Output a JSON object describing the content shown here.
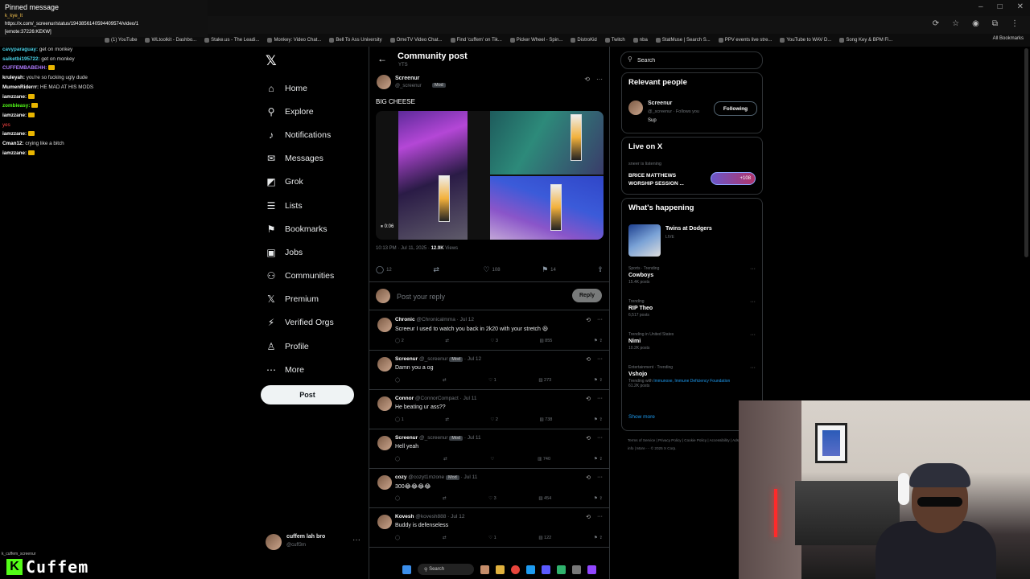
{
  "browser": {
    "window_controls": [
      "–",
      "□",
      "✕"
    ],
    "icons": [
      "⟳",
      "☆",
      "◉",
      "⧉",
      "⋮"
    ],
    "bookmarks": [
      "(1) YouTube",
      "WLtoolkit - Dashbo...",
      "Stake.us - The Leadi...",
      "Monkey: Video Chat...",
      "Bell To Ass University",
      "OmeTV Video Chat...",
      "Find 'cuffem' on Tik...",
      "Picker Wheel - Spin...",
      "DistroKid",
      "Twitch",
      "nba",
      "StatMuse | Search S...",
      "PPV events live stre...",
      "YouTube to WAV D...",
      "Song Key & BPM Fi..."
    ],
    "all_bookmarks": "All Bookmarks"
  },
  "pinned": {
    "title": "Pinned message",
    "user": "k_kye_lt",
    "url": "https://x.com/_screenur/status/1943856140594409574/video/1",
    "emote": "[emote:37226:KEKW]"
  },
  "chat": [
    {
      "user": "cavyparaguay:",
      "text": "get on monkey",
      "color": "#4bd3e8"
    },
    {
      "user": "saiketbi195722:",
      "text": "get on monkey",
      "color": "#4bd3e8"
    },
    {
      "user": "CUFFEMBABEHH:",
      "text": "",
      "emote": true,
      "color": "#b07cff"
    },
    {
      "user": "kruleyah:",
      "text": "you're so fucking ugly dude",
      "color": "#ffffff"
    },
    {
      "user": "MumenRiderrr:",
      "text": "HE MAD AT HIS MODS",
      "color": "#ffffff"
    },
    {
      "user": "iamzzane:",
      "text": "",
      "emote": true,
      "color": "#ffffff"
    },
    {
      "user": "zombieasy:",
      "text": "",
      "emote": true,
      "color": "#53fc18"
    },
    {
      "user": "iamzzane:",
      "text": "",
      "emote": true,
      "color": "#ffffff"
    },
    {
      "user": "",
      "text": "yes",
      "color": "#ff4444"
    },
    {
      "user": "iamzzane:",
      "text": "",
      "emote": true,
      "color": "#ffffff"
    },
    {
      "user": "Cman12:",
      "text": "crying like a bitch",
      "color": "#ffffff"
    },
    {
      "user": "iamzzane:",
      "text": "",
      "emote": true,
      "color": "#ffffff"
    }
  ],
  "chat_footer": "k_cuffem_screenur",
  "nav": [
    {
      "label": "Home",
      "icon": "⌂",
      "name": "home"
    },
    {
      "label": "Explore",
      "icon": "⚲",
      "name": "explore"
    },
    {
      "label": "Notifications",
      "icon": "♪",
      "name": "notifications"
    },
    {
      "label": "Messages",
      "icon": "✉",
      "name": "messages"
    },
    {
      "label": "Grok",
      "icon": "◩",
      "name": "grok"
    },
    {
      "label": "Lists",
      "icon": "☰",
      "name": "lists"
    },
    {
      "label": "Bookmarks",
      "icon": "⚑",
      "name": "bookmarks"
    },
    {
      "label": "Jobs",
      "icon": "▣",
      "name": "jobs"
    },
    {
      "label": "Communities",
      "icon": "⚇",
      "name": "communities"
    },
    {
      "label": "Premium",
      "icon": "𝕏",
      "name": "premium"
    },
    {
      "label": "Verified Orgs",
      "icon": "⚡",
      "name": "verified-orgs"
    },
    {
      "label": "Profile",
      "icon": "♙",
      "name": "profile"
    },
    {
      "label": "More",
      "icon": "⋯",
      "name": "more"
    }
  ],
  "x_logo": "𝕏",
  "post_button": "Post",
  "profile": {
    "name": "cuffem lah bro",
    "handle": "@cuff3m",
    "more": "···"
  },
  "main": {
    "back": "←",
    "title": "Community post",
    "subtitle": "YTS",
    "post": {
      "author": "Screenur",
      "handle": "@_screenur",
      "mod": "Mod",
      "text": "BIG CHEESE",
      "video_time": "0:06",
      "time": "10:13 PM · Jul 11, 2025 · ",
      "views_count": "12.9K",
      "views_label": " Views",
      "actions": {
        "replies": "12",
        "reposts": "",
        "likes": "108",
        "bookmarks": "14"
      }
    },
    "reply_placeholder": "Post your reply",
    "reply_button": "Reply",
    "replies": [
      {
        "name": "Chronic",
        "meta": "@Chronicalmma · Jul 12",
        "mod": "",
        "text": "Screeur I used to watch you back in 2k20 with your stretch 😃",
        "replies": "2",
        "reposts": "",
        "likes": "3",
        "views": "855"
      },
      {
        "name": "Screenur",
        "meta": "@_screenur",
        "mod": "Mod",
        "date": "· Jul 12",
        "text": "Damn you a og",
        "replies": "",
        "reposts": "",
        "likes": "1",
        "views": "273"
      },
      {
        "name": "Connor",
        "meta": "@ConnorCompact · Jul 11",
        "mod": "",
        "text": "He beating ur ass??",
        "replies": "1",
        "reposts": "",
        "likes": "2",
        "views": "738"
      },
      {
        "name": "Screenur",
        "meta": "@_screenur",
        "mod": "Mod",
        "date": "· Jul 11",
        "text": "Hell yeah",
        "replies": "",
        "reposts": "",
        "likes": "",
        "views": "740"
      },
      {
        "name": "cozy",
        "meta": "@cozyt1mzone",
        "mod": "Mod",
        "date": "· Jul 11",
        "text": "300😂😂😂😂",
        "replies": "",
        "reposts": "",
        "likes": "3",
        "views": "454"
      },
      {
        "name": "Kovesh",
        "meta": "@kovesh888 · Jul 12",
        "mod": "",
        "text": "Buddy is defenseless",
        "replies": "",
        "reposts": "",
        "likes": "1",
        "views": "122"
      }
    ]
  },
  "right": {
    "search_placeholder": "Search",
    "relevant": {
      "title": "Relevant people",
      "name": "Screenur",
      "handle": "@_screenur · Follows you",
      "bio": "Sup",
      "button": "Following"
    },
    "live": {
      "title": "Live on X",
      "host": "sneer is listening",
      "space_title": "BRICE MATTHEWS WORSHIP SESSION ...",
      "listeners": "+108"
    },
    "happening": {
      "title": "What's happening",
      "featured_title": "Twins at Dodgers",
      "featured_sub": "LIVE",
      "trends": [
        {
          "cat": "Sports · Trending",
          "name": "Cowboys",
          "count": "15.4K posts"
        },
        {
          "cat": "Trending",
          "name": "RIP Theo",
          "count": "6,517 posts"
        },
        {
          "cat": "Trending in United States",
          "name": "Nimi",
          "count": "10.2K posts"
        },
        {
          "cat": "Entertainment · Trending",
          "name": "Vshojo",
          "count_prefix": "Trending with ",
          "count_link": "Immunoxe, Immune Deficiency Foundation",
          "count": "61.2K posts"
        }
      ],
      "show_more": "Show more"
    },
    "footer": "Terms of Service  |  Privacy Policy  |  Cookie Policy  |  Accessibility  |  Ads info  |  More ···  © 2025 X Corp."
  },
  "taskbar": {
    "search": "Search"
  },
  "stream_logo": {
    "k": "K",
    "text": "Cuffem"
  }
}
